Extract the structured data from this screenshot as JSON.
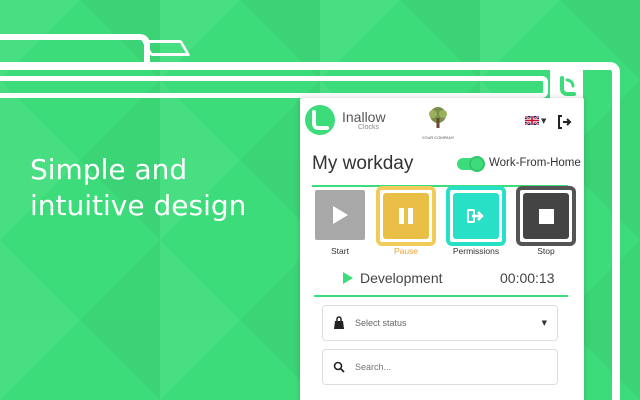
{
  "headline": {
    "line1": "Simple and",
    "line2": "intuitive design"
  },
  "popup": {
    "logo": {
      "name": "Inallow",
      "sub": "Clocks"
    },
    "company_name": "YOUR COMPANY",
    "title": "My workday",
    "work_from_home": {
      "label": "Work-From-Home",
      "enabled": true
    },
    "controls": [
      {
        "label": "Start"
      },
      {
        "label": "Pause"
      },
      {
        "label": "Permissions"
      },
      {
        "label": "Stop"
      }
    ],
    "activity": {
      "name": "Development",
      "timer": "00:00:13"
    },
    "status_select": {
      "placeholder": "Select status"
    },
    "search": {
      "placeholder": "Search..."
    }
  },
  "colors": {
    "accent": "#3ddc7a",
    "pause": "#e9bf45",
    "permissions": "#27e0c5",
    "stop": "#444444",
    "start": "#a8a8a8"
  },
  "icons": [
    "inallow-logo-icon",
    "company-tree-logo",
    "uk-flag-icon",
    "logout-icon",
    "play-icon",
    "pause-icon",
    "arrow-right-icon",
    "stop-icon",
    "status-bag-icon",
    "chevron-down-icon",
    "search-icon"
  ]
}
